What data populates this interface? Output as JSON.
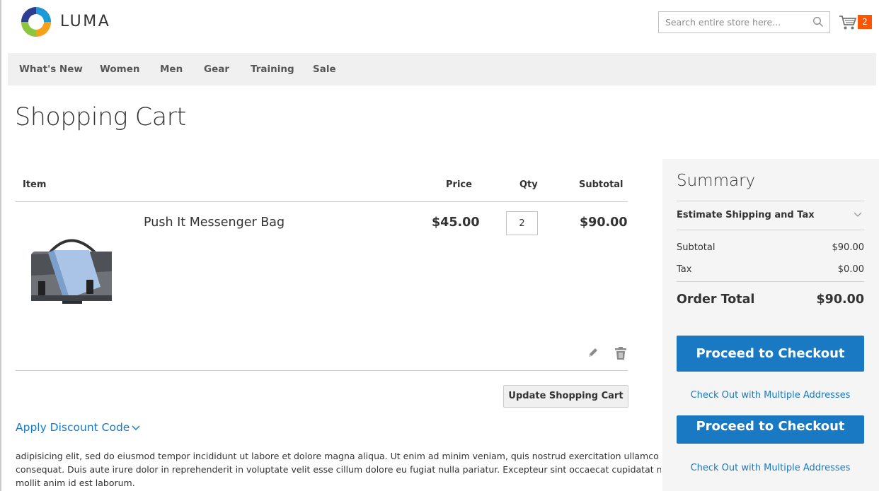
{
  "header": {
    "logo_text": "LUMA",
    "search": {
      "placeholder": "Search entire store here..."
    },
    "cart": {
      "count": "2"
    }
  },
  "nav": {
    "items": [
      "What's New",
      "Women",
      "Men",
      "Gear",
      "Training",
      "Sale"
    ]
  },
  "page": {
    "title": "Shopping Cart"
  },
  "cart_table": {
    "columns": {
      "item": "Item",
      "price": "Price",
      "qty": "Qty",
      "subtotal": "Subtotal"
    },
    "rows": [
      {
        "name": "Push It Messenger Bag",
        "price": "$45.00",
        "qty": "2",
        "subtotal": "$90.00"
      }
    ],
    "update_label": "Update Shopping Cart"
  },
  "discount": {
    "label": "Apply Discount Code"
  },
  "description": {
    "lines": [
      "adipisicing elit, sed do eiusmod tempor incididunt ut labore et dolore magna aliqua. Ut enim ad minim veniam, quis nostrud exercitation ullamco",
      "consequat. Duis aute irure dolor in reprehenderit in voluptate velit esse cillum dolore eu fugiat nulla pariatur. Excepteur sint occaecat cupidatat non",
      "mollit anim id est laborum."
    ]
  },
  "summary": {
    "title": "Summary",
    "shipping_label": "Estimate Shipping and Tax",
    "subtotal_label": "Subtotal",
    "subtotal_value": "$90.00",
    "tax_label": "Tax",
    "tax_value": "$0.00",
    "order_total_label": "Order Total",
    "order_total_value": "$90.00",
    "checkout_label": "Proceed to Checkout",
    "multi_address_label": "Check Out with Multiple Addresses"
  },
  "colors": {
    "accent": "#1979c3",
    "badge": "#ff5501",
    "nav_bg": "#f0f0f0",
    "summary_bg": "#f5f5f5"
  },
  "icons": [
    "luma-logo-icon",
    "search-icon",
    "cart-icon",
    "edit-icon",
    "trash-icon",
    "chevron-down-icon"
  ]
}
